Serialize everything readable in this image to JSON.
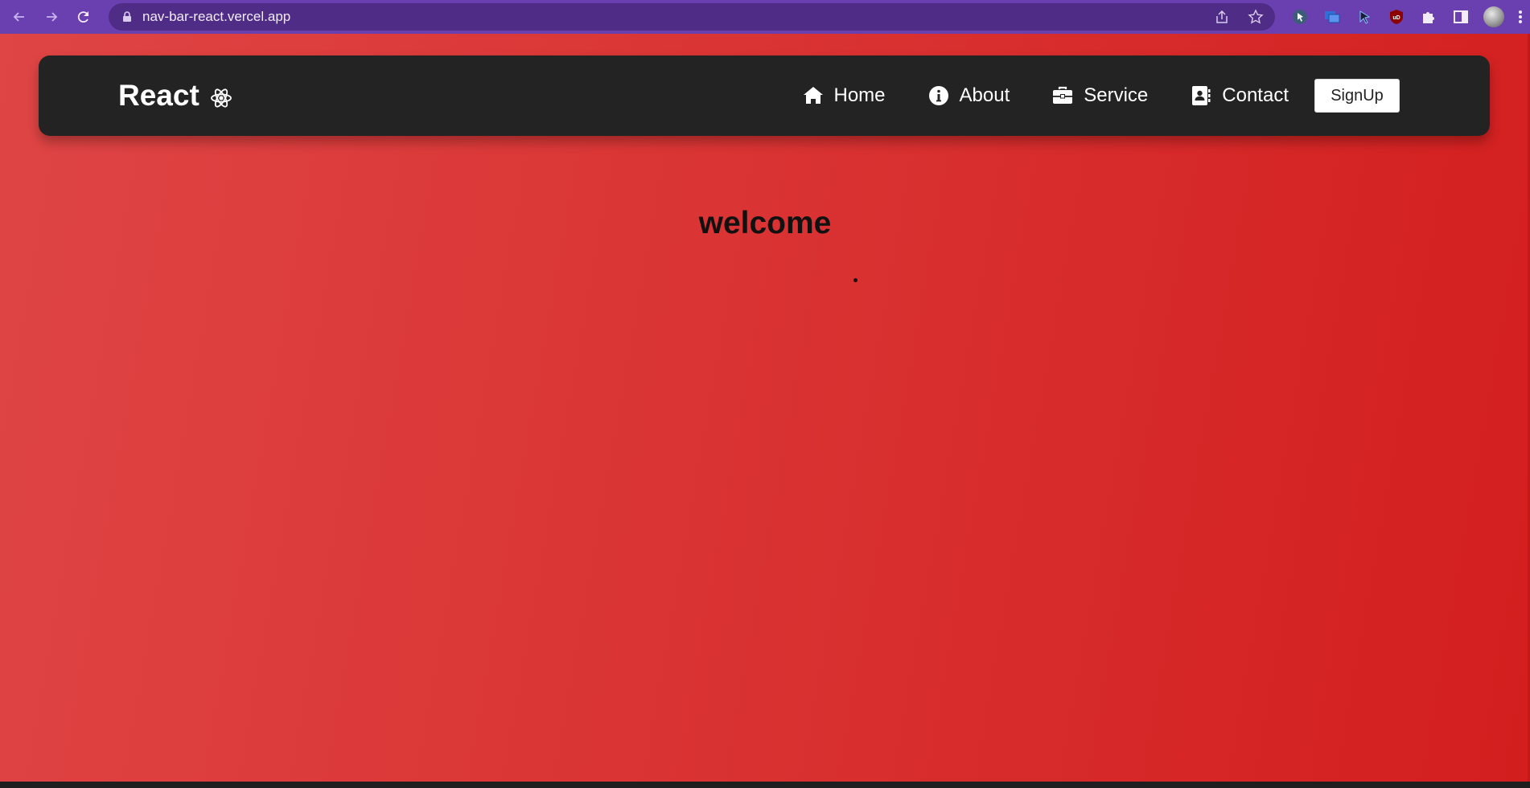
{
  "browser": {
    "url": "nav-bar-react.vercel.app",
    "back_icon": "arrow-left-icon",
    "forward_icon": "arrow-right-icon",
    "reload_icon": "reload-icon",
    "extensions": [
      "cursor-extension-icon",
      "window-extension-icon",
      "pointer-extension-icon",
      "ublock-icon",
      "puzzle-icon",
      "sidebar-icon",
      "avatar"
    ],
    "chrome_color": "#6a3fb0"
  },
  "navbar": {
    "brand": "React",
    "brand_icon": "react-atom-icon",
    "links": [
      {
        "label": "Home",
        "icon": "home-icon"
      },
      {
        "label": "About",
        "icon": "info-icon"
      },
      {
        "label": "Service",
        "icon": "briefcase-icon"
      },
      {
        "label": "Contact",
        "icon": "address-book-icon"
      }
    ],
    "signup_label": "SignUp",
    "background": "#232323"
  },
  "main": {
    "heading": "welcome",
    "background_gradient": [
      "#df4545",
      "#d31e1e"
    ]
  }
}
